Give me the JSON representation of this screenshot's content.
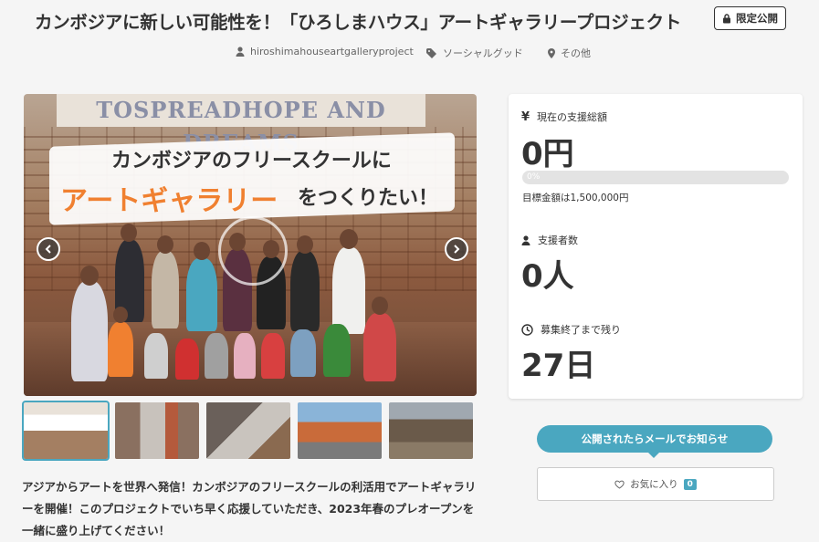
{
  "project": {
    "title": "カンボジアに新しい可能性を！「ひろしまハウス」アートギャラリープロジェクト",
    "badge": "限定公開",
    "owner": "hiroshimahouseartgalleryproject",
    "category": "ソーシャルグッド",
    "location": "その他"
  },
  "hero": {
    "banner_text": "TOSPREADHOPE AND DREAMS",
    "overlay_line1": "カンボジアのフリースクールに",
    "overlay_line2_orange": "アートギャラリー",
    "overlay_line2_tail": "をつくりたい！",
    "prev_icon": "chevron-left-icon",
    "next_icon": "chevron-right-icon"
  },
  "thumbnails": [
    {
      "name": "thumb-1",
      "active": true
    },
    {
      "name": "thumb-2",
      "active": false
    },
    {
      "name": "thumb-3",
      "active": false
    },
    {
      "name": "thumb-4",
      "active": false
    },
    {
      "name": "thumb-5",
      "active": false
    }
  ],
  "description": "アジアからアートを世界へ発信！カンボジアのフリースクールの利活用でアートギャラリーを開催！このプロジェクトでいち早く応援していただき、2023年春のプレオープンを一緒に盛り上げてください！",
  "stats": {
    "total_label": "現在の支援総額",
    "total_value": "0円",
    "progress_text": "0%",
    "progress_percent": 0,
    "goal_text": "目標金額は1,500,000円",
    "supporters_label": "支援者数",
    "supporters_value": "0人",
    "remaining_label": "募集終了まで残り",
    "remaining_value": "27日"
  },
  "actions": {
    "notify_label": "公開されたらメールでお知らせ",
    "favorite_label": "お気に入り",
    "favorite_count": "0"
  },
  "colors": {
    "accent": "#4aa7c0",
    "orange": "#f08030",
    "text": "#333333"
  }
}
